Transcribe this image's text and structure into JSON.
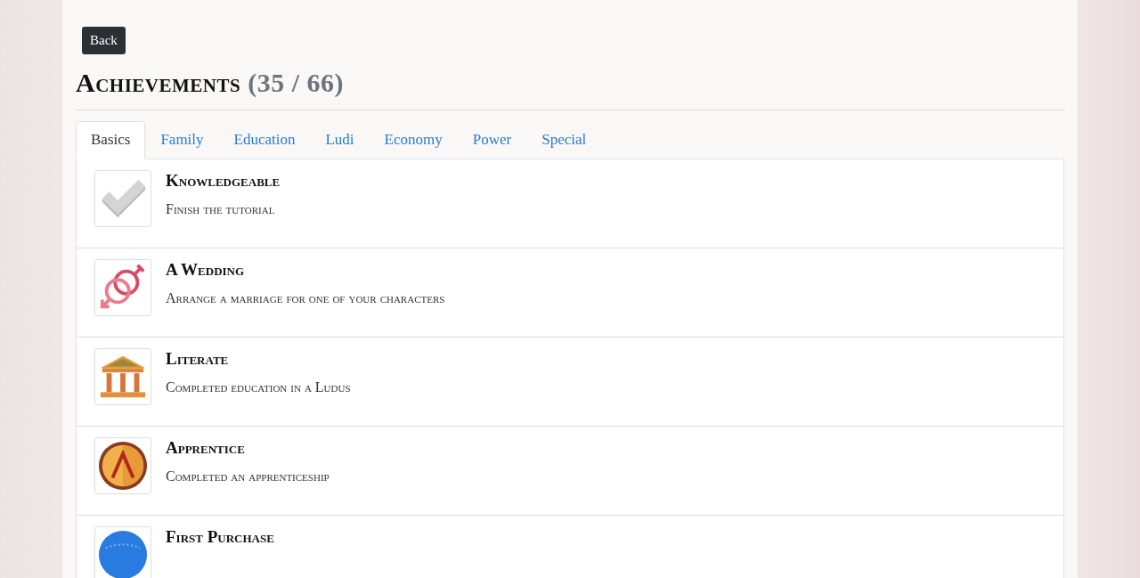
{
  "back_button": "Back",
  "heading": {
    "title": "Achievements",
    "count": "(35 / 66)"
  },
  "tabs": [
    {
      "label": "Basics",
      "selected": true
    },
    {
      "label": "Family",
      "selected": false
    },
    {
      "label": "Education",
      "selected": false
    },
    {
      "label": "Ludi",
      "selected": false
    },
    {
      "label": "Economy",
      "selected": false
    },
    {
      "label": "Power",
      "selected": false
    },
    {
      "label": "Special",
      "selected": false
    }
  ],
  "achievements": [
    {
      "kind": "check",
      "title": "Knowledgeable",
      "description": "Finish the tutorial"
    },
    {
      "kind": "rings",
      "title": "A Wedding",
      "description": "Arrange a marriage for one of your characters"
    },
    {
      "kind": "temple",
      "title": "Literate",
      "description": "Completed education in a Ludus"
    },
    {
      "kind": "shield",
      "title": "Apprentice",
      "description": "Completed an apprenticeship"
    },
    {
      "kind": "globe",
      "title": "First Purchase"
    }
  ]
}
